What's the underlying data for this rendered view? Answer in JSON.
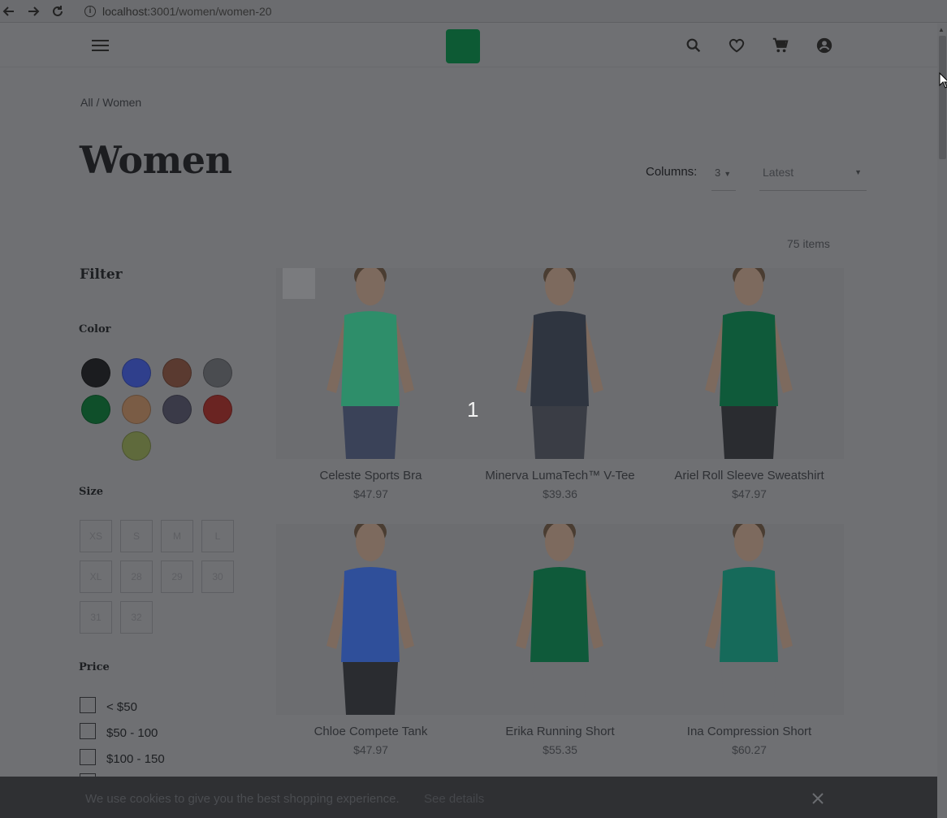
{
  "browser": {
    "url_host": "localhost:",
    "url_rest": "3001/women/women-20"
  },
  "header": {
    "icons": [
      "menu-icon",
      "search-icon",
      "heart-icon",
      "cart-icon",
      "account-icon"
    ]
  },
  "breadcrumb": "All / Women",
  "page_title": "Women",
  "controls": {
    "columns_label": "Columns:",
    "columns_value": "3",
    "sort_value": "Latest"
  },
  "items_count": "75 items",
  "filter": {
    "title": "Filter",
    "color_heading": "Color",
    "colors": [
      "#1b1c1f",
      "#2f3f8c",
      "#5a3a30",
      "#4a4c50",
      "#0f4f2a",
      "#7a5c45",
      "#3a3a48",
      "#6a2422",
      "#5f6a3c"
    ],
    "size_heading": "Size",
    "sizes": [
      "XS",
      "S",
      "M",
      "L",
      "XL",
      "28",
      "29",
      "30",
      "31",
      "32"
    ],
    "price_heading": "Price",
    "prices": [
      "< $50",
      "$50 - 100",
      "$100 - 150"
    ]
  },
  "slide_number": "1",
  "products": [
    {
      "name": "Celeste Sports Bra",
      "price": "$47.97",
      "top_color": "#2e8e6a",
      "bottom_color": "#3a4258"
    },
    {
      "name": "Minerva LumaTech™ V-Tee",
      "price": "$39.36",
      "top_color": "#2f3540",
      "bottom_color": "#3a3d45"
    },
    {
      "name": "Ariel Roll Sleeve Sweatshirt",
      "price": "$47.97",
      "top_color": "#0f5a3a",
      "bottom_color": "#2a2c30"
    },
    {
      "name": "Chloe Compete Tank",
      "price": "$47.97",
      "top_color": "#2f4f9a",
      "bottom_color": "#2a2c30"
    },
    {
      "name": "Erika Running Short",
      "price": "$55.35",
      "top_color": "#0f5a3a",
      "bottom_color": "#6c6d70"
    },
    {
      "name": "Ina Compression Short",
      "price": "$60.27",
      "top_color": "#166a5a",
      "bottom_color": "#6c6d70"
    }
  ],
  "cookie": {
    "text": "We use cookies to give you the best shopping experience.",
    "link": "See details"
  }
}
